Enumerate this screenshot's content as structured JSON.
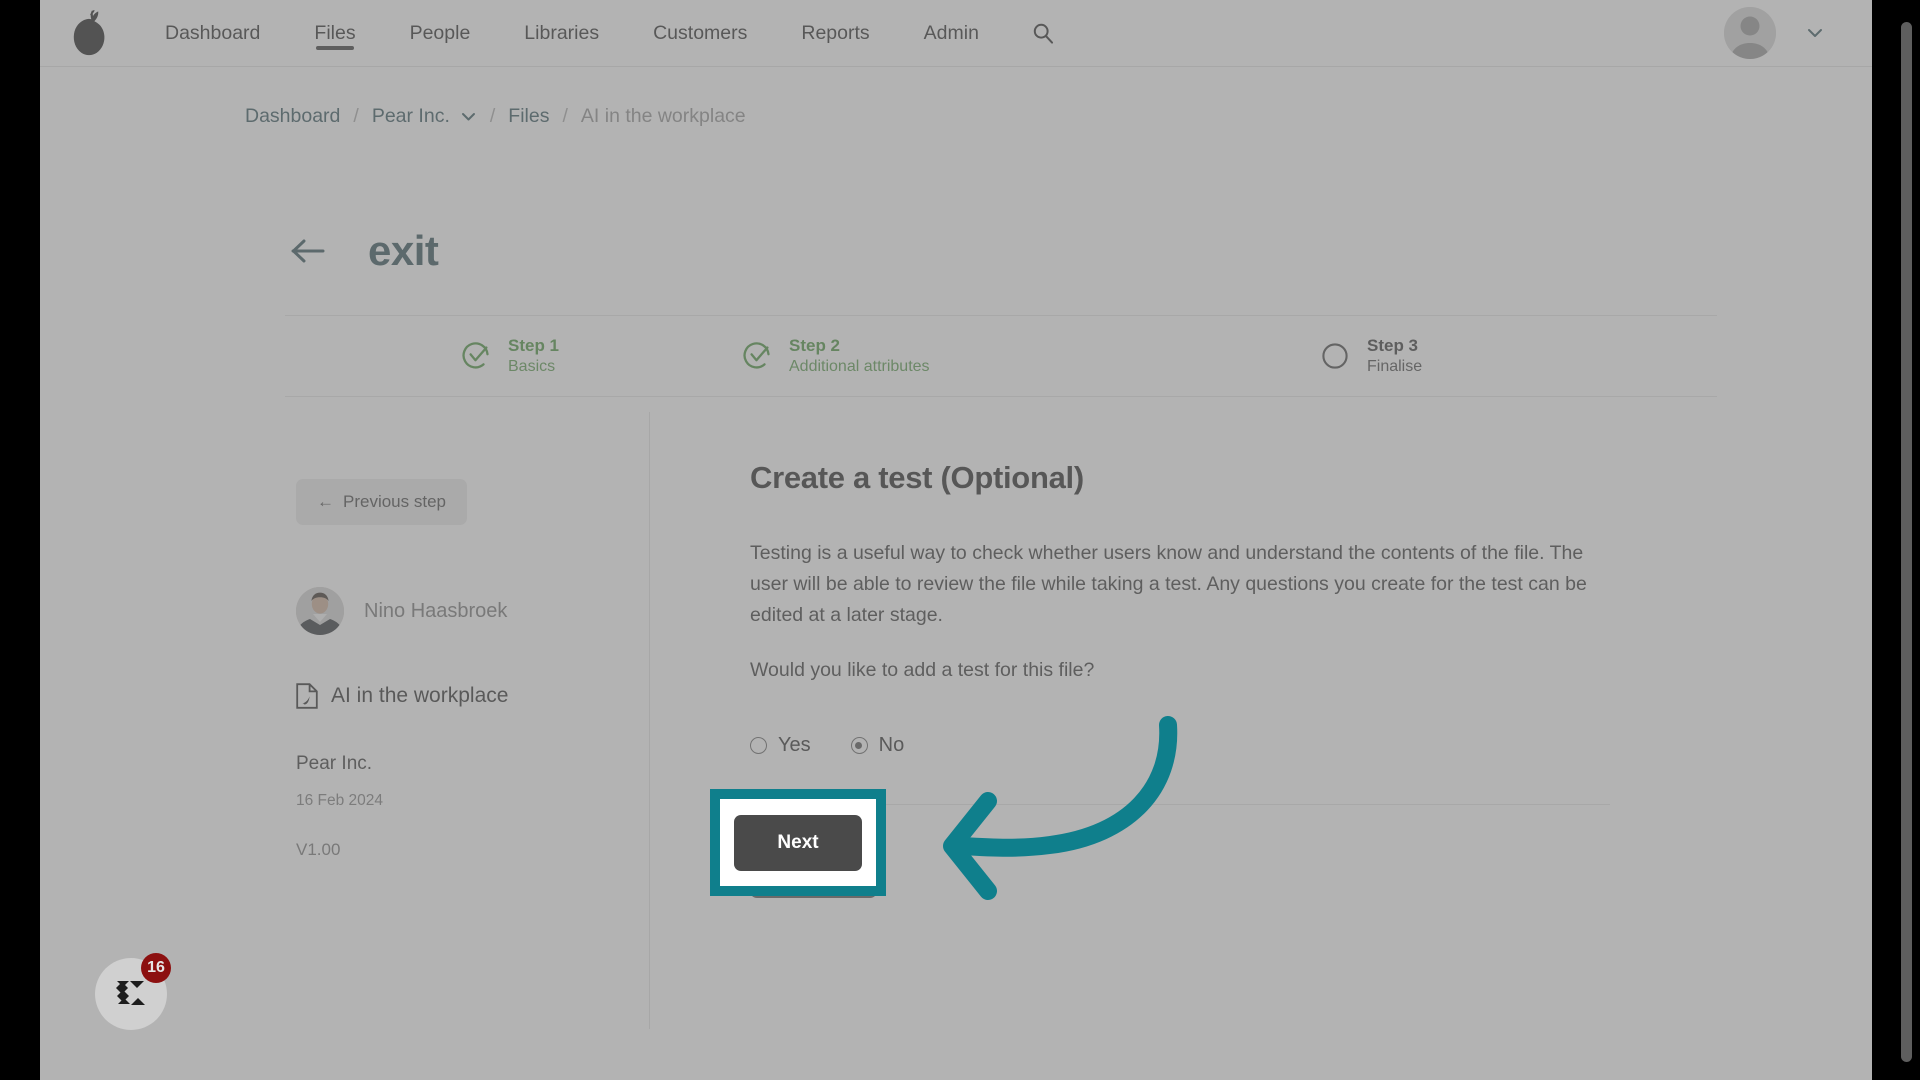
{
  "colors": {
    "accent_teal": "#0f7f8c",
    "title_teal": "#27484f",
    "breadcrumb_link": "#2a4b54",
    "step_done_green": "#3f8d33",
    "next_button_gray": "#4a4a4a",
    "badge_red": "#8c1010",
    "page_background": "#ffffff",
    "dim_overlay": "rgba(128,128,128,0.60)"
  },
  "topnav": {
    "logo_icon": "pear-logo-icon",
    "links": [
      {
        "label": "Dashboard",
        "active": false
      },
      {
        "label": "Files",
        "active": true
      },
      {
        "label": "People",
        "active": false
      },
      {
        "label": "Libraries",
        "active": false
      },
      {
        "label": "Customers",
        "active": false
      },
      {
        "label": "Reports",
        "active": false
      },
      {
        "label": "Admin",
        "active": false
      }
    ],
    "search_icon": "search-icon",
    "avatar_icon": "user-avatar-placeholder-icon",
    "account_chevron_icon": "chevron-down-icon"
  },
  "breadcrumb": {
    "items": [
      {
        "label": "Dashboard",
        "type": "link"
      },
      {
        "label": "Pear Inc.",
        "type": "link",
        "has_dropdown": true
      },
      {
        "label": "Files",
        "type": "link"
      },
      {
        "label": "AI in the workplace",
        "type": "current"
      }
    ],
    "separator": "/",
    "dropdown_icon": "chevron-down-icon"
  },
  "page_header": {
    "back_icon": "arrow-left-icon",
    "title": "exit"
  },
  "stepper": {
    "steps": [
      {
        "number": "Step 1",
        "label": "Basics",
        "state": "done",
        "icon": "check-circle-icon"
      },
      {
        "number": "Step 2",
        "label": "Additional attributes",
        "state": "done",
        "icon": "check-circle-icon"
      },
      {
        "number": "Step 3",
        "label": "Finalise",
        "state": "todo",
        "icon": "empty-circle-icon"
      }
    ]
  },
  "sidebar": {
    "previous_step": {
      "label": "Previous step",
      "arrow_glyph": "←",
      "icon": "arrow-left-icon"
    },
    "uploader": {
      "name": "Nino Haasbroek",
      "avatar_icon": "user-photo-avatar"
    },
    "file": {
      "name": "AI in the workplace",
      "icon": "pdf-file-icon"
    },
    "organisation": "Pear Inc.",
    "date": "16 Feb 2024",
    "version": "V1.00"
  },
  "main": {
    "title": "Create a test (Optional)",
    "paragraph": "Testing is a useful way to check whether users know and understand the contents of the file. The user will be able to review the file while taking a test. Any questions you create for the test can be edited at a later stage.",
    "question": "Would you like to add a test for this file?",
    "radio_options": [
      {
        "label": "Yes",
        "value": "yes",
        "selected": false
      },
      {
        "label": "No",
        "value": "no",
        "selected": true
      }
    ],
    "next_button_label": "Next"
  },
  "annotation": {
    "highlight_target": "next-button",
    "arrow_icon": "curved-arrow-left-icon",
    "arrow_color": "#0f7f8c"
  },
  "help_widget": {
    "logo_icon": "chameleon-c-logo-icon",
    "badge_count": "16"
  }
}
